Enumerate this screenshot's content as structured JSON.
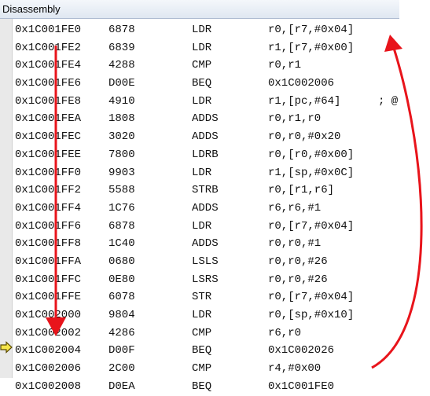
{
  "window": {
    "title": "Disassembly"
  },
  "rows": [
    {
      "addr": "0x1C001FE0",
      "opcode": "6878",
      "mnemonic": "LDR",
      "operands": "r0,[r7,#0x04]",
      "comment": ""
    },
    {
      "addr": "0x1C001FE2",
      "opcode": "6839",
      "mnemonic": "LDR",
      "operands": "r1,[r7,#0x00]",
      "comment": ""
    },
    {
      "addr": "0x1C001FE4",
      "opcode": "4288",
      "mnemonic": "CMP",
      "operands": "r0,r1",
      "comment": ""
    },
    {
      "addr": "0x1C001FE6",
      "opcode": "D00E",
      "mnemonic": "BEQ",
      "operands": "0x1C002006",
      "comment": ""
    },
    {
      "addr": "0x1C001FE8",
      "opcode": "4910",
      "mnemonic": "LDR",
      "operands": "r1,[pc,#64]",
      "comment": "; @"
    },
    {
      "addr": "0x1C001FEA",
      "opcode": "1808",
      "mnemonic": "ADDS",
      "operands": "r0,r1,r0",
      "comment": ""
    },
    {
      "addr": "0x1C001FEC",
      "opcode": "3020",
      "mnemonic": "ADDS",
      "operands": "r0,r0,#0x20",
      "comment": ""
    },
    {
      "addr": "0x1C001FEE",
      "opcode": "7800",
      "mnemonic": "LDRB",
      "operands": "r0,[r0,#0x00]",
      "comment": ""
    },
    {
      "addr": "0x1C001FF0",
      "opcode": "9903",
      "mnemonic": "LDR",
      "operands": "r1,[sp,#0x0C]",
      "comment": ""
    },
    {
      "addr": "0x1C001FF2",
      "opcode": "5588",
      "mnemonic": "STRB",
      "operands": "r0,[r1,r6]",
      "comment": ""
    },
    {
      "addr": "0x1C001FF4",
      "opcode": "1C76",
      "mnemonic": "ADDS",
      "operands": "r6,r6,#1",
      "comment": ""
    },
    {
      "addr": "0x1C001FF6",
      "opcode": "6878",
      "mnemonic": "LDR",
      "operands": "r0,[r7,#0x04]",
      "comment": ""
    },
    {
      "addr": "0x1C001FF8",
      "opcode": "1C40",
      "mnemonic": "ADDS",
      "operands": "r0,r0,#1",
      "comment": ""
    },
    {
      "addr": "0x1C001FFA",
      "opcode": "0680",
      "mnemonic": "LSLS",
      "operands": "r0,r0,#26",
      "comment": ""
    },
    {
      "addr": "0x1C001FFC",
      "opcode": "0E80",
      "mnemonic": "LSRS",
      "operands": "r0,r0,#26",
      "comment": ""
    },
    {
      "addr": "0x1C001FFE",
      "opcode": "6078",
      "mnemonic": "STR",
      "operands": "r0,[r7,#0x04]",
      "comment": ""
    },
    {
      "addr": "0x1C002000",
      "opcode": "9804",
      "mnemonic": "LDR",
      "operands": "r0,[sp,#0x10]",
      "comment": ""
    },
    {
      "addr": "0x1C002002",
      "opcode": "4286",
      "mnemonic": "CMP",
      "operands": "r6,r0",
      "comment": ""
    },
    {
      "addr": "0x1C002004",
      "opcode": "D00F",
      "mnemonic": "BEQ",
      "operands": "0x1C002026",
      "comment": ""
    },
    {
      "addr": "0x1C002006",
      "opcode": "2C00",
      "mnemonic": "CMP",
      "operands": "r4,#0x00",
      "comment": ""
    },
    {
      "addr": "0x1C002008",
      "opcode": "D0EA",
      "mnemonic": "BEQ",
      "operands": "0x1C001FE0",
      "comment": ""
    }
  ],
  "current_row": 19,
  "colors": {
    "arrow": "#e8141b",
    "marker_fill": "#f6e64a",
    "marker_stroke": "#5a4a00"
  },
  "icons": {
    "current_line": "current-instruction-arrow-icon"
  }
}
